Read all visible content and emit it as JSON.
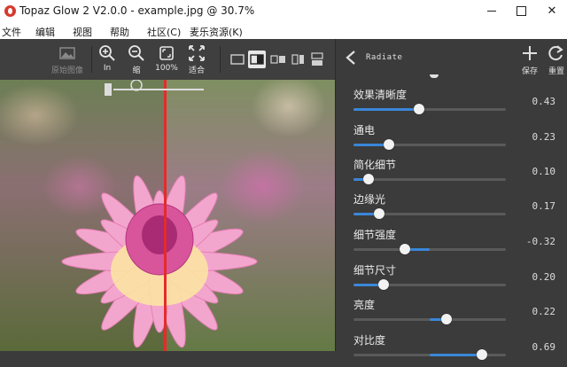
{
  "window": {
    "title": "Topaz Glow 2 V2.0.0 - example.jpg @ 30.7%",
    "controls": {
      "minimize": "",
      "maximize": "",
      "close": "✕"
    }
  },
  "menu": [
    "文件",
    "编辑",
    "视图",
    "帮助",
    "社区(C)",
    "麦乐资源(K)"
  ],
  "toolbar": {
    "original_label": "原始图像",
    "zoom_in_label": "In",
    "zoom_out_label": "缩",
    "zoom_100_label": "100%",
    "fit_label": "适合"
  },
  "panel": {
    "preset_name": "Radiate",
    "save_label": "保存",
    "reset_label": "重置",
    "params": [
      {
        "name": "效果清晰度",
        "value": "0.43",
        "fraction": 0.43,
        "signed": false
      },
      {
        "name": "通电",
        "value": "0.23",
        "fraction": 0.23,
        "signed": false
      },
      {
        "name": "简化细节",
        "value": "0.10",
        "fraction": 0.1,
        "signed": false
      },
      {
        "name": "边缘光",
        "value": "0.17",
        "fraction": 0.17,
        "signed": false
      },
      {
        "name": "细节强度",
        "value": "-0.32",
        "fraction": -0.32,
        "signed": true
      },
      {
        "name": "细节尺寸",
        "value": "0.20",
        "fraction": 0.2,
        "signed": false
      },
      {
        "name": "亮度",
        "value": "0.22",
        "fraction": 0.22,
        "signed": true
      },
      {
        "name": "对比度",
        "value": "0.69",
        "fraction": 0.69,
        "signed": true
      }
    ]
  },
  "colors": {
    "accent": "#3a86d8",
    "split_line": "#e52b2b"
  }
}
